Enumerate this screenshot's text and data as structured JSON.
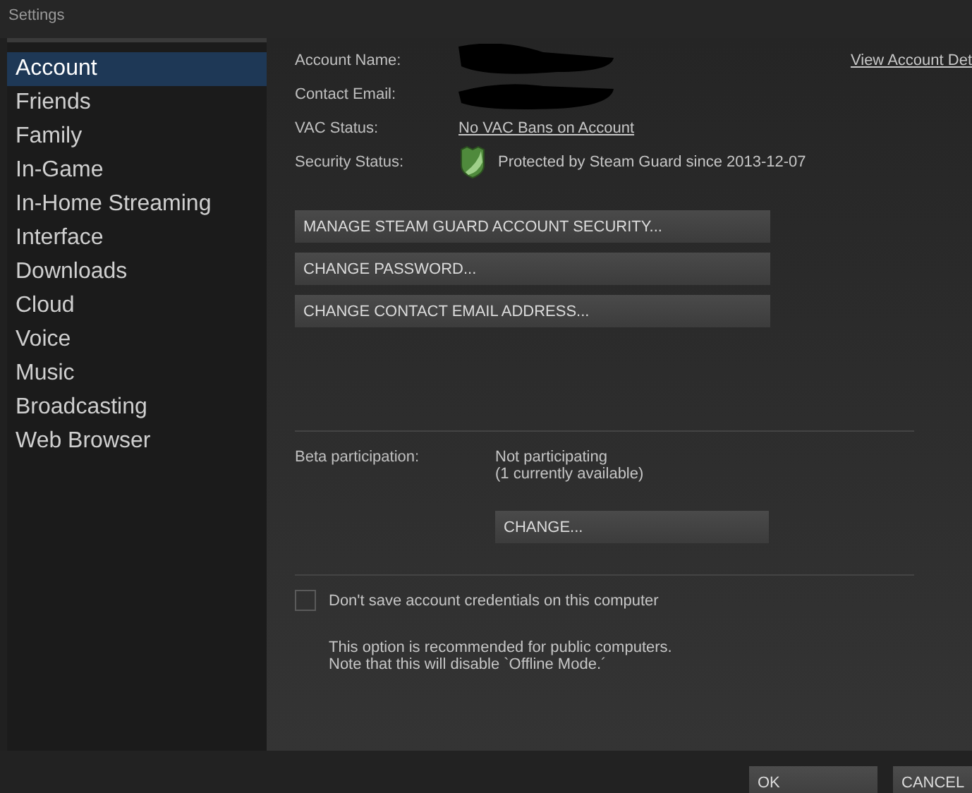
{
  "window": {
    "title": "Settings"
  },
  "sidebar": {
    "items": [
      {
        "label": "Account",
        "selected": true
      },
      {
        "label": "Friends",
        "selected": false
      },
      {
        "label": "Family",
        "selected": false
      },
      {
        "label": "In-Game",
        "selected": false
      },
      {
        "label": "In-Home Streaming",
        "selected": false
      },
      {
        "label": "Interface",
        "selected": false
      },
      {
        "label": "Downloads",
        "selected": false
      },
      {
        "label": "Cloud",
        "selected": false
      },
      {
        "label": "Voice",
        "selected": false
      },
      {
        "label": "Music",
        "selected": false
      },
      {
        "label": "Broadcasting",
        "selected": false
      },
      {
        "label": "Web Browser",
        "selected": false
      }
    ]
  },
  "account": {
    "view_details_link": "View Account Det",
    "rows": [
      {
        "label": "Account Name:",
        "kind": "redacted"
      },
      {
        "label": "Contact Email:",
        "kind": "redacted"
      },
      {
        "label": "VAC Status:",
        "kind": "link",
        "value": "No VAC Bans on Account"
      },
      {
        "label": "Security Status:",
        "kind": "shield",
        "value": "Protected by Steam Guard since 2013-12-07"
      }
    ],
    "buttons": [
      "MANAGE STEAM GUARD ACCOUNT SECURITY...",
      "CHANGE PASSWORD...",
      "CHANGE CONTACT EMAIL ADDRESS..."
    ]
  },
  "beta": {
    "label": "Beta participation:",
    "status": "Not participating",
    "note": "(1 currently available)",
    "button": "CHANGE..."
  },
  "credentials": {
    "label": "Don't save account credentials on this computer",
    "checked": false,
    "help": [
      "This option is recommended for public computers.",
      "Note that this will disable `Offline Mode.´"
    ]
  },
  "footer": {
    "buttons": [
      "OK",
      "CANCEL"
    ]
  }
}
